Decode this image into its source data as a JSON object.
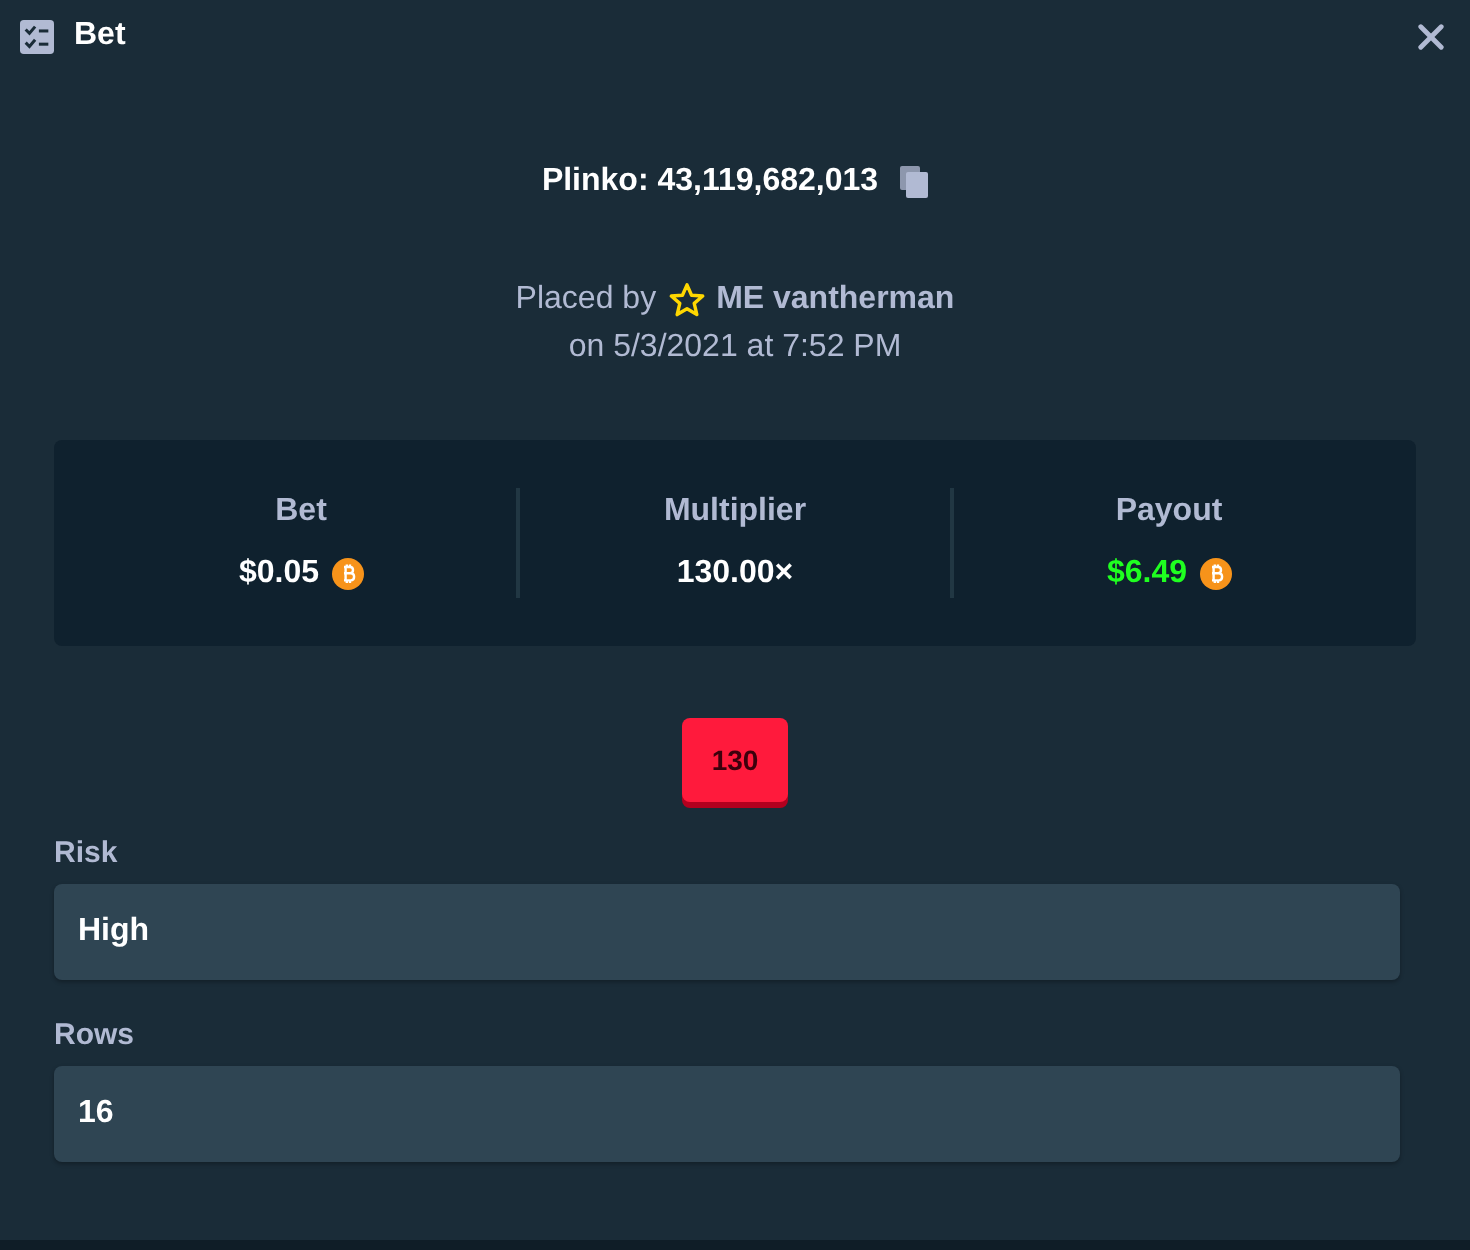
{
  "window": {
    "title": "Bet"
  },
  "game": {
    "title": "Plinko: 43,119,682,013"
  },
  "placed": {
    "prefix": "Placed by",
    "user": "ME vantherman",
    "date": "on 5/3/2021 at 7:52 PM"
  },
  "stats": [
    {
      "label": "Bet",
      "value": "$0.05",
      "kind": "amount"
    },
    {
      "label": "Multiplier",
      "value": "130.00×",
      "kind": "plain"
    },
    {
      "label": "Payout",
      "value": "$6.49",
      "kind": "payout"
    }
  ],
  "multiplier_tile": {
    "value": "130"
  },
  "fields": [
    {
      "label": "Risk",
      "value": "High"
    },
    {
      "label": "Rows",
      "value": "16"
    }
  ]
}
